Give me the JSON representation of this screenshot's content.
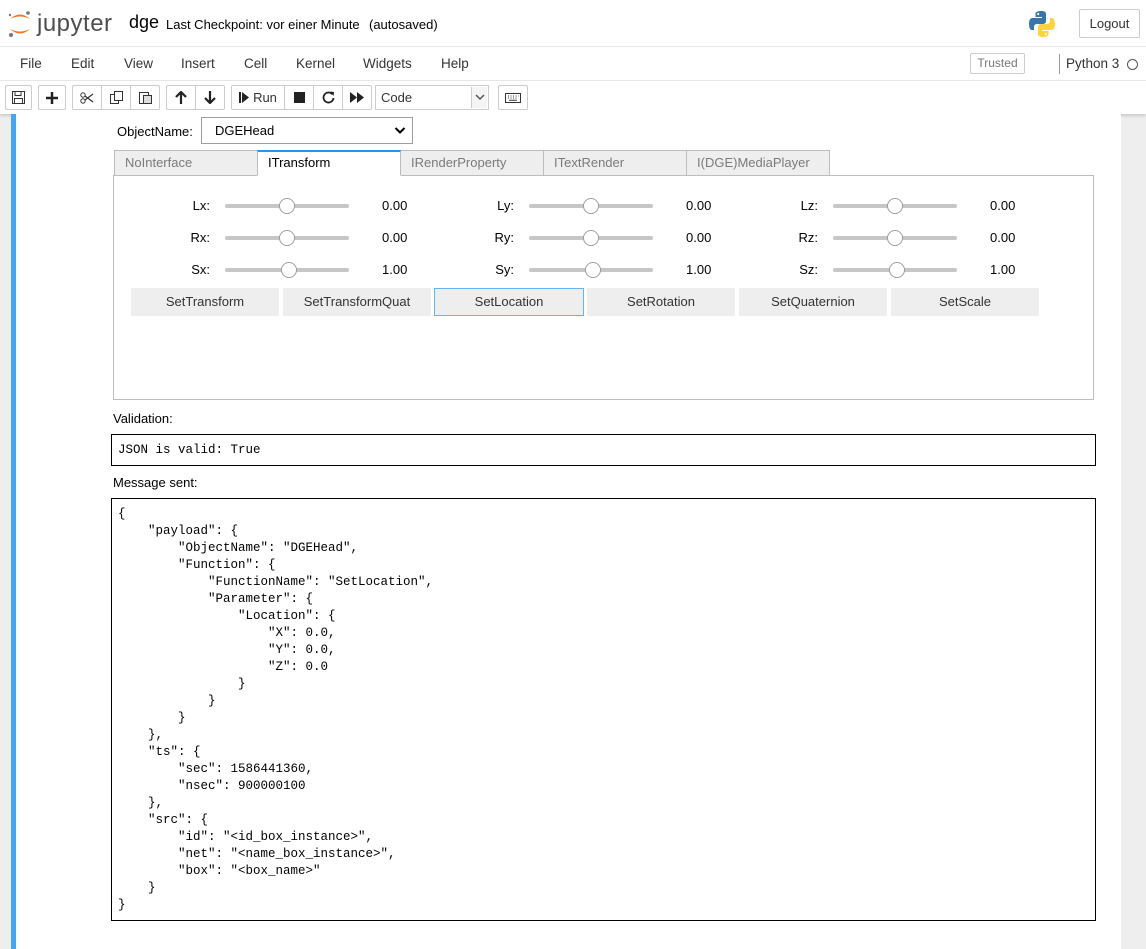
{
  "header": {
    "logo_text": "jupyter",
    "notebook_name": "dge",
    "checkpoint": "Last Checkpoint: vor einer Minute",
    "autosave": "(autosaved)",
    "logout_label": "Logout"
  },
  "menubar": {
    "items": [
      "File",
      "Edit",
      "View",
      "Insert",
      "Cell",
      "Kernel",
      "Widgets",
      "Help"
    ],
    "trusted": "Trusted",
    "kernel_name": "Python 3"
  },
  "toolbar": {
    "run_label": "Run",
    "cell_type": "Code"
  },
  "widget": {
    "objectname_label": "ObjectName:",
    "objectname_value": "DGEHead",
    "tabs": [
      "NoInterface",
      "ITransform",
      "IRenderProperty",
      "ITextRender",
      "I(DGE)MediaPlayer"
    ],
    "active_tab": "ITransform",
    "sliders": [
      {
        "label": "Lx:",
        "value": "0.00",
        "level": 0.5
      },
      {
        "label": "Ly:",
        "value": "0.00",
        "level": 0.5
      },
      {
        "label": "Lz:",
        "value": "0.00",
        "level": 0.5
      },
      {
        "label": "Rx:",
        "value": "0.00",
        "level": 0.5
      },
      {
        "label": "Ry:",
        "value": "0.00",
        "level": 0.5
      },
      {
        "label": "Rz:",
        "value": "0.00",
        "level": 0.5
      },
      {
        "label": "Sx:",
        "value": "1.00",
        "level": 0.52
      },
      {
        "label": "Sy:",
        "value": "1.00",
        "level": 0.52
      },
      {
        "label": "Sz:",
        "value": "1.00",
        "level": 0.52
      }
    ],
    "buttons": [
      "SetTransform",
      "SetTransformQuat",
      "SetLocation",
      "SetRotation",
      "SetQuaternion",
      "SetScale"
    ],
    "focused_button": "SetLocation"
  },
  "validation": {
    "label": "Validation:",
    "text": "JSON is valid: True"
  },
  "message": {
    "label": "Message sent:",
    "json_text": "{\n    \"payload\": {\n        \"ObjectName\": \"DGEHead\",\n        \"Function\": {\n            \"FunctionName\": \"SetLocation\",\n            \"Parameter\": {\n                \"Location\": {\n                    \"X\": 0.0,\n                    \"Y\": 0.0,\n                    \"Z\": 0.0\n                }\n            }\n        }\n    },\n    \"ts\": {\n        \"sec\": 1586441360,\n        \"nsec\": 900000100\n    },\n    \"src\": {\n        \"id\": \"<id_box_instance>\",\n        \"net\": \"<name_box_instance>\",\n        \"box\": \"<box_name>\"\n    }\n}"
  }
}
